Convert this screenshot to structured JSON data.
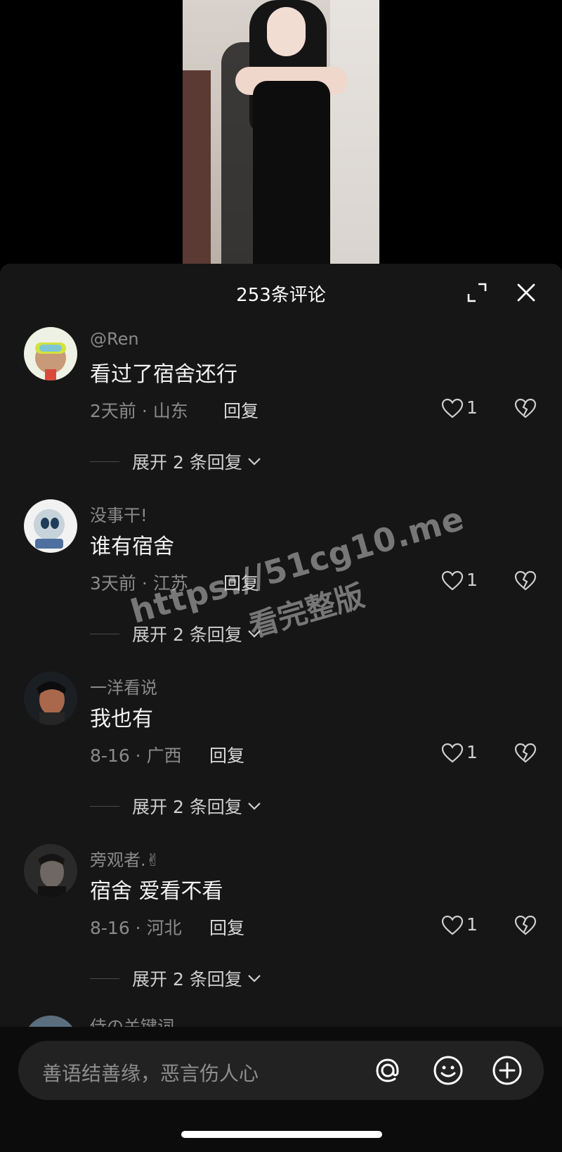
{
  "header": {
    "title": "253条评论"
  },
  "comments": [
    {
      "username": "@Ren",
      "text": "看过了宿舍还行",
      "meta": "2天前 · 山东",
      "reply": "回复",
      "likes": "1",
      "expand": "展开 2 条回复",
      "avatar_colors": [
        "#e9f0d8",
        "#d7e44a",
        "#b98b6c"
      ]
    },
    {
      "username": "没事干!",
      "text": "谁有宿舍",
      "meta": "3天前 · 江苏",
      "reply": "回复",
      "likes": "1",
      "expand": "展开 2 条回复",
      "avatar_colors": [
        "#e6e6e6",
        "#b7c6cf",
        "#3a5b7a"
      ]
    },
    {
      "username": "一洋看说",
      "text": "我也有",
      "meta": "8-16 · 广西",
      "reply": "回复",
      "likes": "1",
      "expand": "展开 2 条回复",
      "avatar_colors": [
        "#1a1e22",
        "#b06a4f",
        "#2d2d2d"
      ]
    },
    {
      "username": "旁观者.✌",
      "text": "宿舍 爱看不看",
      "meta": "8-16 · 河北",
      "reply": "回复",
      "likes": "1",
      "expand": "展开 2 条回复",
      "avatar_colors": [
        "#2a2a2a",
        "#6b6560",
        "#151515"
      ]
    }
  ],
  "partial_comment": {
    "username": "侍の关键词"
  },
  "input": {
    "placeholder": "善语结善缘，恶言伤人心"
  },
  "watermark": {
    "url": "https://51cg10.me",
    "sub": "看完整版"
  }
}
